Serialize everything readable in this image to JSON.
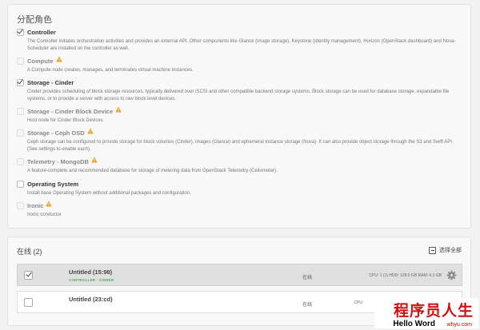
{
  "roles_section": {
    "title": "分配角色",
    "roles": [
      {
        "name": "Controller",
        "checked": true,
        "disabled": false,
        "warning": false,
        "desc": "The Controller initiates orchestration activities and provides an external API. Other components like Glance (image storage), Keystone (identity management), Horizon (OpenStack dashboard) and Nova-Scheduler are installed on the controller as well."
      },
      {
        "name": "Compute",
        "checked": false,
        "disabled": true,
        "warning": true,
        "desc": "A Compute node creates, manages, and terminates virtual machine instances."
      },
      {
        "name": "Storage - Cinder",
        "checked": true,
        "disabled": false,
        "warning": false,
        "desc": "Cinder provides scheduling of block storage resources, typically delivered over iSCSI and other compatible backend storage systems. Block storage can be used for database storage, expandable file systems, or to provide a server with access to raw block level devices."
      },
      {
        "name": "Storage - Cinder Block Device",
        "checked": false,
        "disabled": true,
        "warning": true,
        "desc": "Host node for Cinder Block Devices"
      },
      {
        "name": "Storage - Ceph OSD",
        "checked": false,
        "disabled": true,
        "warning": true,
        "desc": "Ceph storage can be configured to provide storage for block volumes (Cinder), images (Glance) and ephemeral instance storage (Nova). It can also provide object storage through the S3 and Swift API (See settings to enable each)."
      },
      {
        "name": "Telemetry - MongoDB",
        "checked": false,
        "disabled": true,
        "warning": true,
        "desc": "A feature-complete and recommended database for storage of metering data from OpenStack Telemetry (Ceilometer)."
      },
      {
        "name": "Operating System",
        "checked": false,
        "disabled": false,
        "warning": false,
        "desc": "Install base Operating System without additional packages and configuration."
      },
      {
        "name": "Ironic",
        "checked": false,
        "disabled": true,
        "warning": true,
        "desc": "Ironic conductor"
      }
    ]
  },
  "nodes_section": {
    "title": "在线 (2)",
    "select_all_label": "选择全部",
    "nodes": [
      {
        "name": "Untitled (15:98)",
        "roles": "CONTROLLER · CINDER",
        "status": "在线",
        "specs": "CPU: 1 (1)  HDD: 128.0 GB  RAM: 4.1 GB",
        "selected": true
      },
      {
        "name": "Untitled (23:cd)",
        "roles": "",
        "status": "在线",
        "specs": "CPU",
        "selected": false
      }
    ]
  },
  "watermark": {
    "cn": "程序员人生",
    "en": "Hello Word",
    "url": "whyu.com"
  },
  "colors": {
    "warning": "#e8a020",
    "roles_green": "#5aa55a",
    "watermark_red": "#cc1111"
  }
}
